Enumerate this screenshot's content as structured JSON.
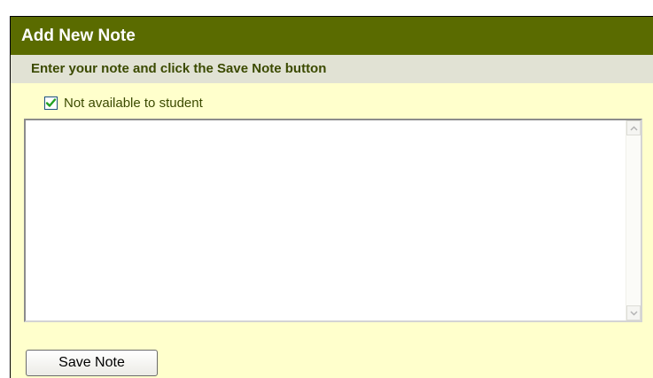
{
  "header": {
    "title": "Add New Note"
  },
  "instructions": {
    "text": "Enter your note and click the Save Note button"
  },
  "checkbox": {
    "label": "Not available to student",
    "checked": true
  },
  "note": {
    "value": ""
  },
  "scrollbar": {
    "up_icon": "chevron-up-icon",
    "down_icon": "chevron-down-icon"
  },
  "actions": {
    "save_label": "Save Note"
  },
  "colors": {
    "header_bg": "#5a6b00",
    "instruction_bg": "#e1e2d4",
    "panel_bg": "#ffffcc",
    "check_mark": "#21a121"
  }
}
